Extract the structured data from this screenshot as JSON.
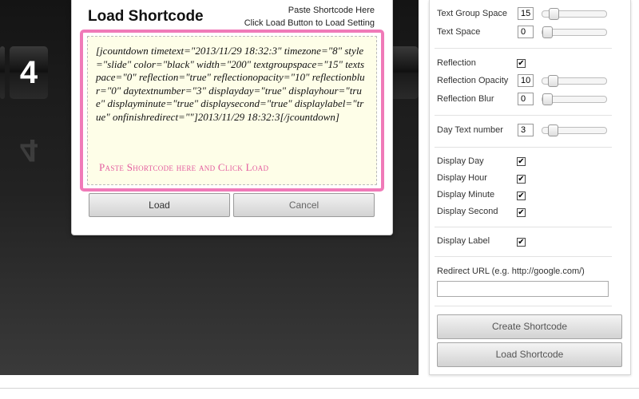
{
  "preview": {
    "digit": "4",
    "reflection_digit": "4"
  },
  "modal": {
    "title": "Load Shortcode",
    "hint_line1": "Paste Shortcode Here",
    "hint_line2": "Click Load Button to Load Setting",
    "shortcode": "[jcountdown timetext=\"2013/11/29 18:32:3\" timezone=\"8\" style=\"slide\" color=\"black\" width=\"200\" textgroupspace=\"15\" textspace=\"0\" reflection=\"true\" reflectionopacity=\"10\" reflectionblur=\"0\" daytextnumber=\"3\" displayday=\"true\" displayhour=\"true\" displayminute=\"true\" displaysecond=\"true\" displaylabel=\"true\" onfinishredirect=\"\"]2013/11/29 18:32:3[/jcountdown]",
    "placeholder": "Paste Shortcode here and Click Load",
    "load_label": "Load",
    "cancel_label": "Cancel"
  },
  "settings": {
    "text_group_space": {
      "label": "Text Group Space",
      "value": "15",
      "level": 0.12
    },
    "text_space": {
      "label": "Text Space",
      "value": "0",
      "level": 0.0
    },
    "reflection": {
      "label": "Reflection",
      "checked": true
    },
    "reflection_opacity": {
      "label": "Reflection Opacity",
      "value": "10",
      "level": 0.1
    },
    "reflection_blur": {
      "label": "Reflection Blur",
      "value": "0",
      "level": 0.0
    },
    "day_text_number": {
      "label": "Day Text number",
      "value": "3",
      "level": 0.1
    },
    "display_day": {
      "label": "Display Day",
      "checked": true
    },
    "display_hour": {
      "label": "Display Hour",
      "checked": true
    },
    "display_minute": {
      "label": "Display Minute",
      "checked": true
    },
    "display_second": {
      "label": "Display Second",
      "checked": true
    },
    "display_label": {
      "label": "Display Label",
      "checked": true
    },
    "redirect_url": {
      "label": "Redirect URL (e.g. http://google.com/)",
      "value": ""
    },
    "create_label": "Create Shortcode",
    "load_label": "Load Shortcode",
    "check_glyph": "✔"
  }
}
